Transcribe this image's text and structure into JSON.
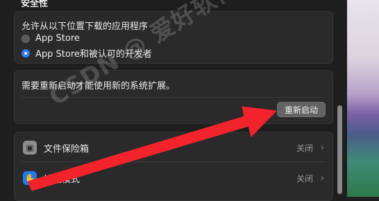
{
  "section": {
    "title": "安全性"
  },
  "download_card": {
    "heading": "允许从以下位置下载的应用程序",
    "options": [
      {
        "label": "App Store",
        "selected": false
      },
      {
        "label": "App Store和被认可的开发者",
        "selected": true
      }
    ]
  },
  "restart_card": {
    "message": "需要重新启动才能使用新的系统扩展。",
    "button_label": "重新启动"
  },
  "settings_rows": [
    {
      "label": "文件保险箱",
      "value": "关闭",
      "icon": "vault-icon"
    },
    {
      "label": "锁定模式",
      "value": "关闭",
      "icon": "lock-icon"
    }
  ],
  "annotation": {
    "color": "#f2232b"
  },
  "watermark": {
    "text": "CSDN @ 爱好软件"
  }
}
